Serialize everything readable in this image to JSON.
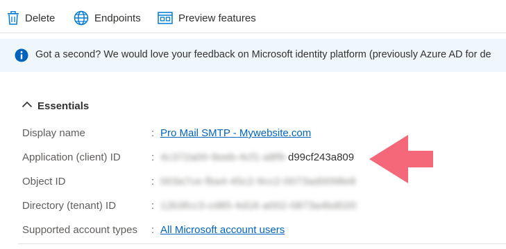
{
  "toolbar": {
    "delete_label": "Delete",
    "endpoints_label": "Endpoints",
    "preview_label": "Preview features"
  },
  "banner": {
    "message": "Got a second? We would love your feedback on Microsoft identity platform (previously Azure AD for de",
    "icon": "info-icon"
  },
  "essentials": {
    "title": "Essentials",
    "rows": [
      {
        "label": "Display name",
        "value": "Pro Mail SMTP - Mywebsite.com"
      },
      {
        "label": "Application (client) ID",
        "value_obscured": "4c372a00-9eeb-4cf1-a8f9-",
        "value_visible": "d99cf243a809"
      },
      {
        "label": "Object ID",
        "value_obscured": "003a7ce-fba4-45c2-9cc2-0073ad0098e8"
      },
      {
        "label": "Directory (tenant) ID",
        "value_obscured": "12b3fcc3-cd85-4d16-a002-0873a4bd020"
      },
      {
        "label": "Supported account types",
        "value": "All Microsoft account users"
      }
    ],
    "colon": ":"
  },
  "colors": {
    "link": "#0064bf",
    "banner_bg": "#eff6fc",
    "info_icon": "#0064bf",
    "arrow": "#f4687a",
    "label": "#605e5c"
  }
}
